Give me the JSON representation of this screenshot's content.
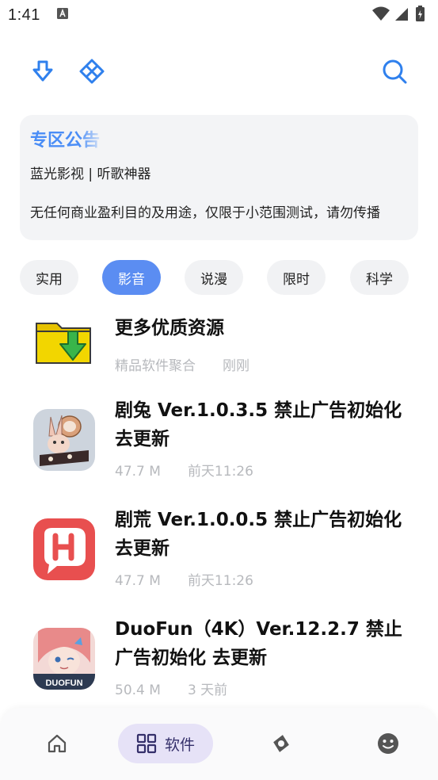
{
  "status_bar": {
    "time": "1:41"
  },
  "top_bar": {
    "icons": [
      "download-arrow-icon",
      "diamond-grid-icon",
      "search-icon"
    ],
    "accent_color": "#2f80ed"
  },
  "notice": {
    "title": "专区公告",
    "subtitle": "蓝光影视 | 听歌神器",
    "body": "无任何商业盈利目的及用途，仅限于小范围测试，请勿传播"
  },
  "categories": [
    {
      "label": "实用",
      "active": false
    },
    {
      "label": "影音",
      "active": true
    },
    {
      "label": "说漫",
      "active": false
    },
    {
      "label": "限时",
      "active": false
    },
    {
      "label": "科学",
      "active": false
    }
  ],
  "apps": [
    {
      "title": "更多优质资源",
      "meta1": "精品软件聚合",
      "meta2": "刚刚",
      "icon": "folder-download-icon"
    },
    {
      "title": "剧兔 Ver.1.0.3.5 禁止广告初始化去更新",
      "meta1": "47.7 M",
      "meta2": "前天11:26",
      "icon": "rabbit-app-icon"
    },
    {
      "title": "剧荒 Ver.1.0.0.5 禁止广告初始化去更新",
      "meta1": "47.7 M",
      "meta2": "前天11:26",
      "icon": "juhuang-app-icon"
    },
    {
      "title": "DuoFun（4K）Ver.12.2.7 禁止广告初始化 去更新",
      "meta1": "50.4 M",
      "meta2": "3 天前",
      "icon": "duofun-app-icon",
      "icon_text": "DUOFUN"
    }
  ],
  "bottom_nav": {
    "items": [
      {
        "icon": "home-icon",
        "active": false
      },
      {
        "icon": "apps-grid-icon",
        "label": "软件",
        "active": true
      },
      {
        "icon": "compass-icon",
        "active": false
      },
      {
        "icon": "smiley-icon",
        "active": false
      }
    ],
    "active_color": "#e6e2f7"
  }
}
